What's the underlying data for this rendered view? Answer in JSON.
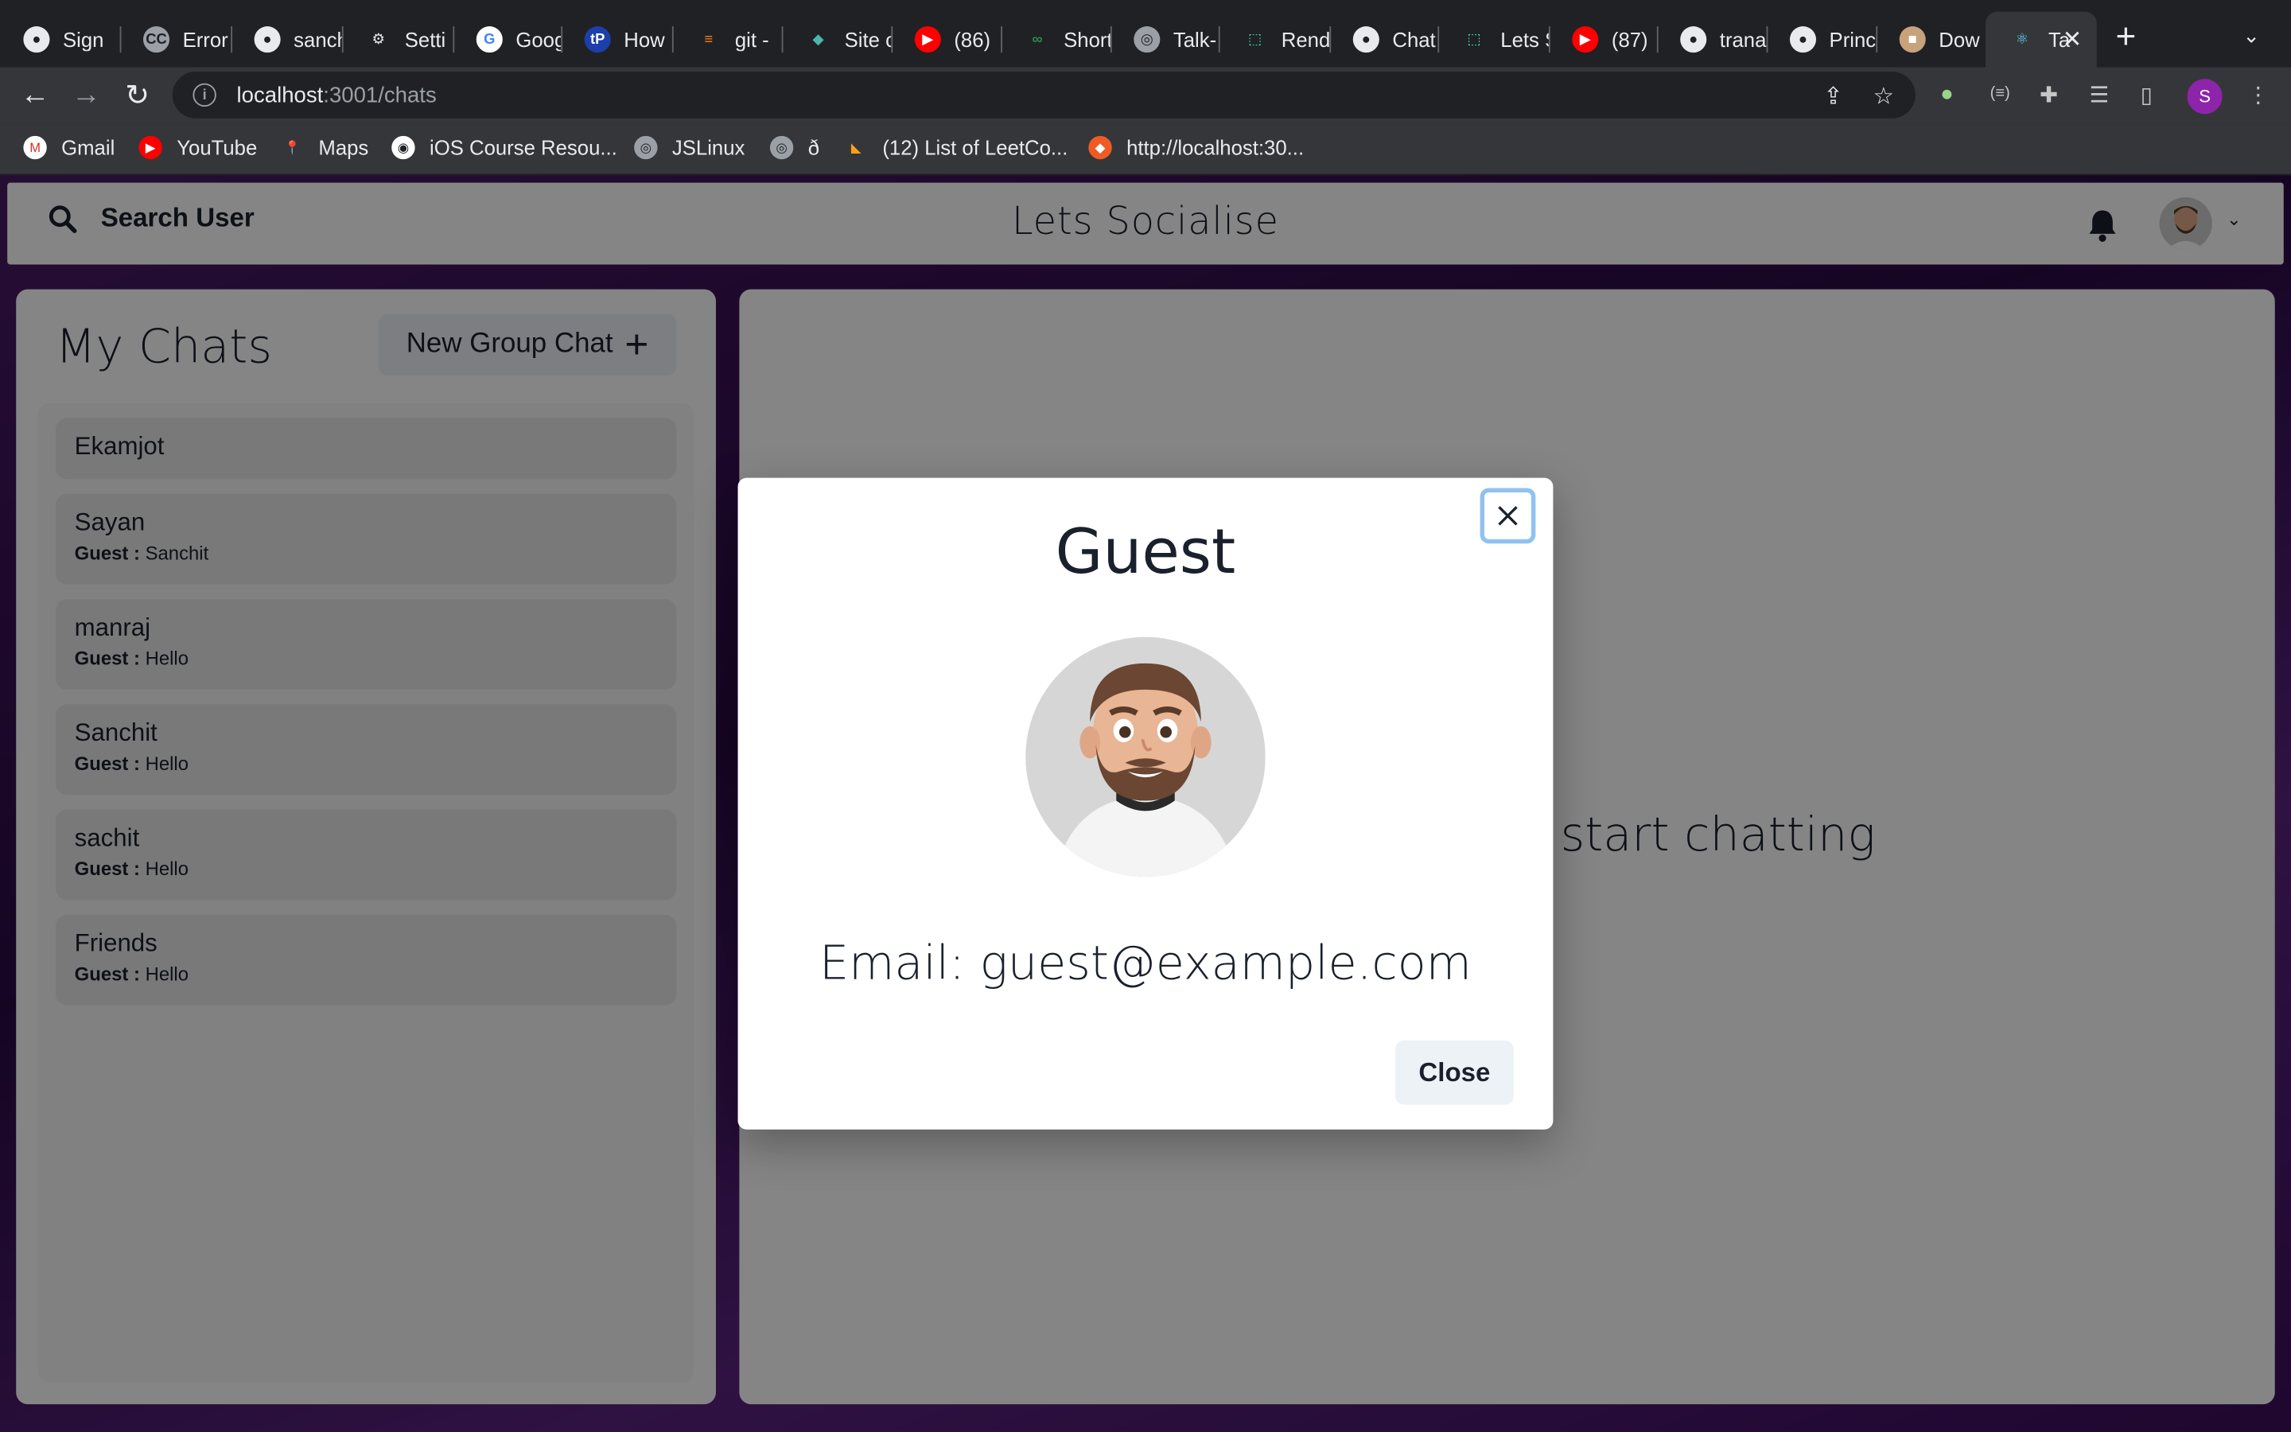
{
  "browser": {
    "tabs": [
      {
        "label": "Sign",
        "icon": "github-icon"
      },
      {
        "label": "Error",
        "icon": "cc-icon"
      },
      {
        "label": "sanch",
        "icon": "github-icon"
      },
      {
        "label": "Setti",
        "icon": "gear-icon"
      },
      {
        "label": "Goog",
        "icon": "google-icon"
      },
      {
        "label": "How",
        "icon": "tp-icon"
      },
      {
        "label": "git - ",
        "icon": "stackoverflow-icon"
      },
      {
        "label": "Site c",
        "icon": "diamond-icon"
      },
      {
        "label": "(86)",
        "icon": "youtube-icon"
      },
      {
        "label": "Short",
        "icon": "gfg-icon"
      },
      {
        "label": "Talk-",
        "icon": "globe-icon"
      },
      {
        "label": "Rend",
        "icon": "render-icon"
      },
      {
        "label": "Chat",
        "icon": "github-icon"
      },
      {
        "label": "Lets S",
        "icon": "render-icon"
      },
      {
        "label": "(87)",
        "icon": "youtube-icon"
      },
      {
        "label": "trana",
        "icon": "github-icon"
      },
      {
        "label": "Princ",
        "icon": "github-icon"
      },
      {
        "label": "Dow",
        "icon": "image-icon"
      },
      {
        "label": "Ta",
        "icon": "react-icon",
        "active": true
      }
    ],
    "url_host": "localhost",
    "url_path": ":3001/chats",
    "profile_initial": "S",
    "bookmarks": [
      {
        "label": "Gmail",
        "icon": "gmail-icon"
      },
      {
        "label": "YouTube",
        "icon": "youtube-icon"
      },
      {
        "label": "Maps",
        "icon": "maps-icon"
      },
      {
        "label": "iOS Course Resou...",
        "icon": "ios-icon"
      },
      {
        "label": "JSLinux",
        "icon": "globe-icon"
      },
      {
        "label": "ð",
        "icon": "globe-icon"
      },
      {
        "label": "(12) List of LeetCo...",
        "icon": "leetcode-icon"
      },
      {
        "label": "http://localhost:30...",
        "icon": "postman-icon"
      }
    ]
  },
  "header": {
    "search_label": "Search User",
    "app_title": "Lets Socialise"
  },
  "sidebar": {
    "title": "My Chats",
    "new_group_label": "New Group Chat",
    "chats": [
      {
        "name": "Ekamjot",
        "sender": "",
        "message": ""
      },
      {
        "name": "Sayan",
        "sender": "Guest : ",
        "message": "Sanchit"
      },
      {
        "name": "manraj",
        "sender": "Guest : ",
        "message": "Hello"
      },
      {
        "name": "Sanchit",
        "sender": "Guest : ",
        "message": "Hello"
      },
      {
        "name": "sachit",
        "sender": "Guest : ",
        "message": "Hello"
      },
      {
        "name": "Friends",
        "sender": "Guest : ",
        "message": "Hello"
      }
    ]
  },
  "main": {
    "placeholder_text": "start chatting"
  },
  "modal": {
    "title": "Guest",
    "email_text": "Email: guest@example.com",
    "close_label": "Close"
  },
  "colors": {
    "accent": "#90c2f0",
    "profile": "#8e24aa"
  }
}
